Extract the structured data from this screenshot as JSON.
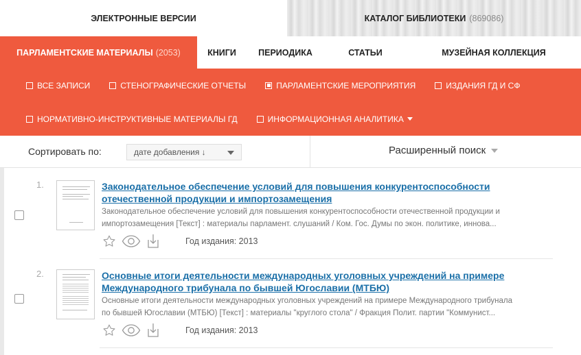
{
  "top_tabs": {
    "left": "ЭЛЕКТРОННЫЕ ВЕРСИИ",
    "right_label": "КАТАЛОГ БИБЛИОТЕКИ",
    "right_count": "(869086)"
  },
  "categories": {
    "active_label": "ПАРЛАМЕНТСКИЕ МАТЕРИАЛЫ",
    "active_count": "(2053)",
    "items": [
      "КНИГИ",
      "ПЕРИОДИКА",
      "СТАТЬИ",
      "МУЗЕЙНАЯ КОЛЛЕКЦИЯ"
    ]
  },
  "filters": {
    "row1": [
      {
        "label": "ВСЕ ЗАПИСИ",
        "checked": false
      },
      {
        "label": "СТЕНОГРАФИЧЕСКИЕ ОТЧЕТЫ",
        "checked": false
      },
      {
        "label": "ПАРЛАМЕНТСКИЕ МЕРОПРИЯТИЯ",
        "checked": true
      },
      {
        "label": "ИЗДАНИЯ ГД И СФ",
        "checked": false
      }
    ],
    "row2": [
      {
        "label": "НОРМАТИВНО-ИНСТРУКТИВНЫЕ МАТЕРИАЛЫ ГД",
        "checked": false
      },
      {
        "label": "ИНФОРМАЦИОННАЯ АНАЛИТИКА",
        "checked": false
      }
    ]
  },
  "sort": {
    "label": "Сортировать по:",
    "value": "дате добавления ↓",
    "advanced_search": "Расширенный поиск"
  },
  "records": [
    {
      "num": "1.",
      "title_line1": "Законодательное обеспечение условий для повышения конкурентоспособности",
      "title_line2": "отечественной продукции и импортозамещения",
      "desc_line1": "Законодательное обеспечение условий для повышения конкурентоспособности отечественной продукции и",
      "desc_line2": "импортозамещения [Текст] : материалы парламент. слушаний / Ком. Гос. Думы по экон. политике, иннова...",
      "year": "Год издания: 2013"
    },
    {
      "num": "2.",
      "title_line1": "Основные итоги деятельности международных уголовных учреждений на примере",
      "title_line2": "Международного трибунала по бывшей Югославии (МТБЮ)",
      "desc_line1": "Основные итоги деятельности международных уголовных учреждений на примере Международного трибунала",
      "desc_line2": "по бывшей Югославии (МТБЮ) [Текст] : материалы \"круглого стола\" / Фракция Полит. партии \"Коммунист...",
      "year": "Год издания: 2013"
    }
  ],
  "colors": {
    "accent": "#ef5a3e",
    "link": "#1a6fa8"
  },
  "icons": [
    "star-icon",
    "eye-icon",
    "download-icon"
  ]
}
